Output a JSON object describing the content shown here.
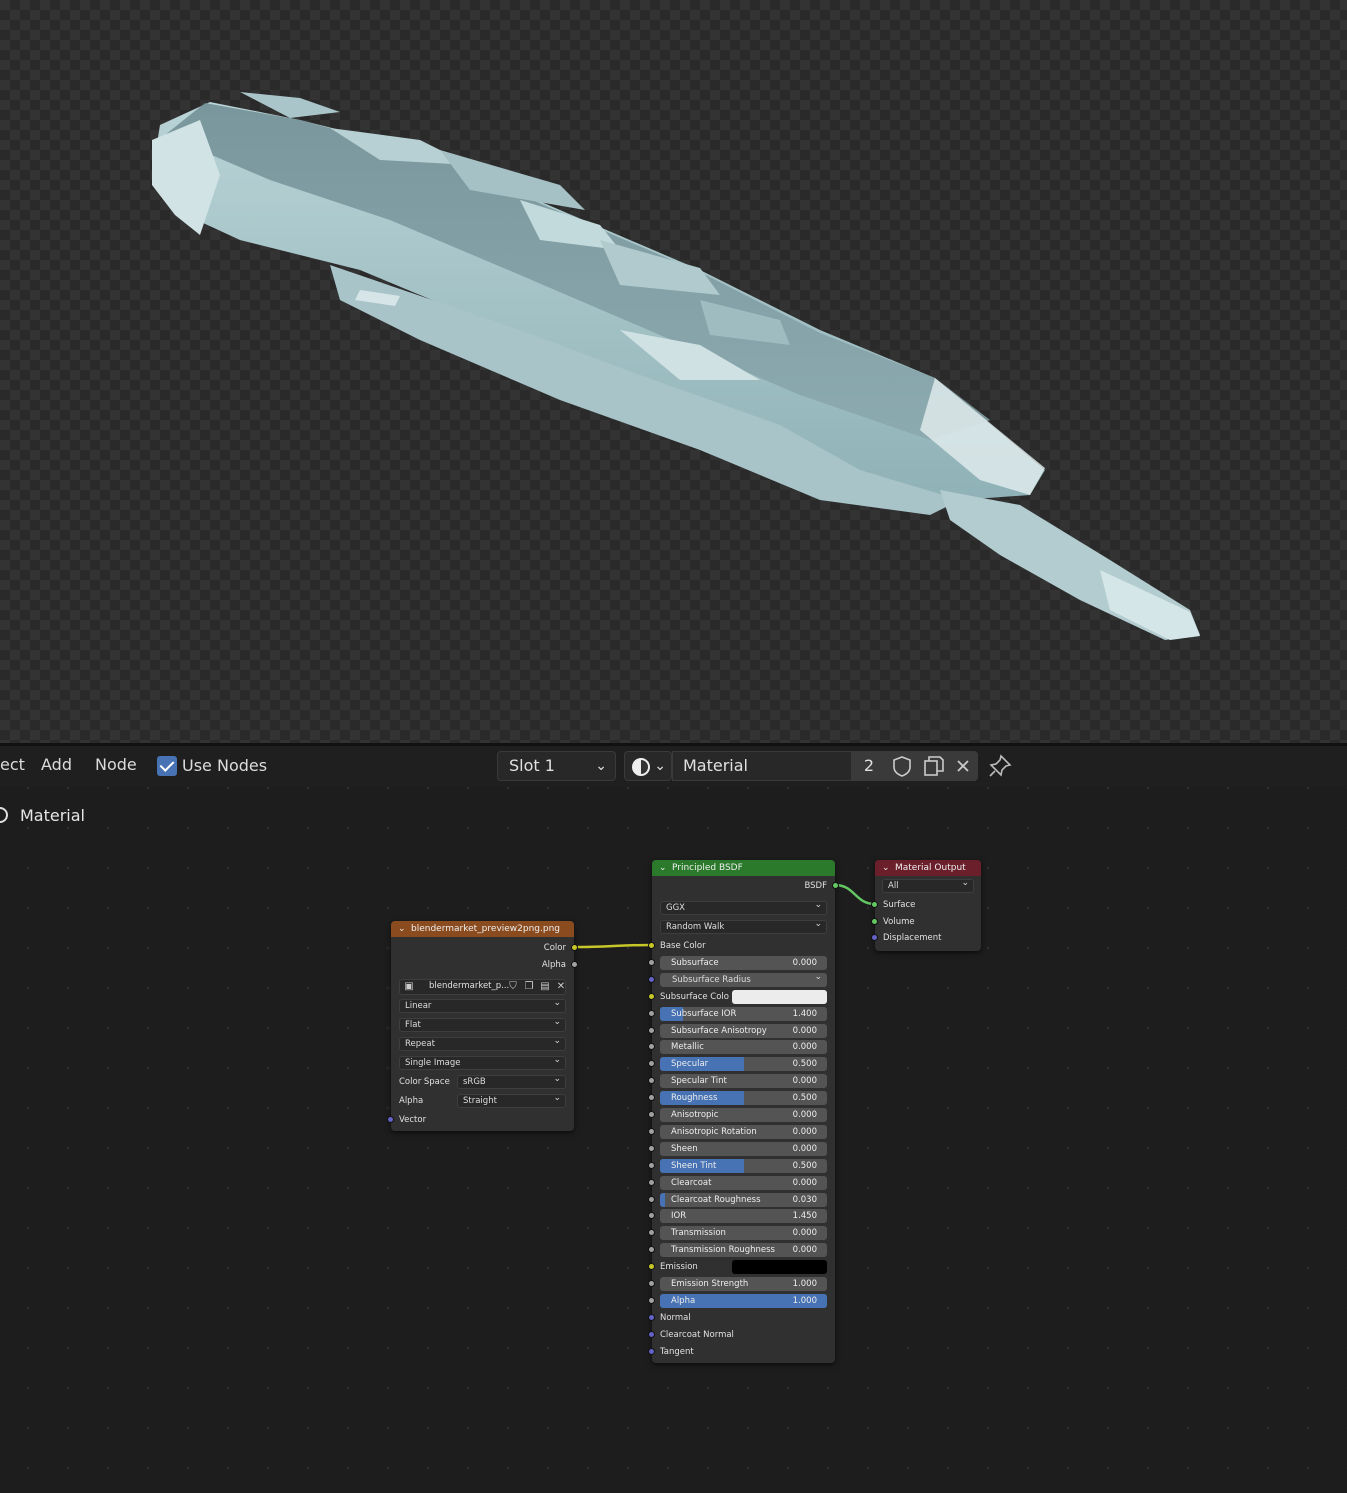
{
  "header": {
    "menu_select": "ect",
    "menu_add": "Add",
    "menu_node": "Node",
    "use_nodes_label": "Use Nodes",
    "use_nodes_checked": true,
    "slot": "Slot 1",
    "material_name": "Material",
    "user_count": "2"
  },
  "breadcrumb": {
    "label": "Material"
  },
  "image_node": {
    "title": "blendermarket_preview2png.png",
    "out_color": "Color",
    "out_alpha": "Alpha",
    "image_name": "blendermarket_p...",
    "interpolation": "Linear",
    "projection": "Flat",
    "extension": "Repeat",
    "source": "Single Image",
    "color_space_label": "Color Space",
    "color_space": "sRGB",
    "alpha_label": "Alpha",
    "alpha_mode": "Straight",
    "in_vector": "Vector"
  },
  "bsdf_node": {
    "title": "Principled BSDF",
    "out_bsdf": "BSDF",
    "distribution": "GGX",
    "subsurface_method": "Random Walk",
    "base_color": "Base Color",
    "subsurface": {
      "label": "Subsurface",
      "value": "0.000",
      "fill": 0
    },
    "subsurface_radius": "Subsurface Radius",
    "subsurface_color": "Subsurface Colo",
    "subsurface_ior": {
      "label": "Subsurface IOR",
      "value": "1.400",
      "fill": 0.14
    },
    "subsurface_anisotropy": {
      "label": "Subsurface Anisotropy",
      "value": "0.000",
      "fill": 0
    },
    "metallic": {
      "label": "Metallic",
      "value": "0.000",
      "fill": 0
    },
    "specular": {
      "label": "Specular",
      "value": "0.500",
      "fill": 0.5
    },
    "specular_tint": {
      "label": "Specular Tint",
      "value": "0.000",
      "fill": 0
    },
    "roughness": {
      "label": "Roughness",
      "value": "0.500",
      "fill": 0.5
    },
    "anisotropic": {
      "label": "Anisotropic",
      "value": "0.000",
      "fill": 0
    },
    "anisotropic_rotation": {
      "label": "Anisotropic Rotation",
      "value": "0.000",
      "fill": 0
    },
    "sheen": {
      "label": "Sheen",
      "value": "0.000",
      "fill": 0
    },
    "sheen_tint": {
      "label": "Sheen Tint",
      "value": "0.500",
      "fill": 0.5
    },
    "clearcoat": {
      "label": "Clearcoat",
      "value": "0.000",
      "fill": 0
    },
    "clearcoat_roughness": {
      "label": "Clearcoat Roughness",
      "value": "0.030",
      "fill": 0.03
    },
    "ior": {
      "label": "IOR",
      "value": "1.450",
      "fill": 0
    },
    "transmission": {
      "label": "Transmission",
      "value": "0.000",
      "fill": 0
    },
    "transmission_roughness": {
      "label": "Transmission Roughness",
      "value": "0.000",
      "fill": 0
    },
    "emission": "Emission",
    "emission_strength": {
      "label": "Emission Strength",
      "value": "1.000",
      "fill": 0
    },
    "alpha": {
      "label": "Alpha",
      "value": "1.000",
      "fill": 1
    },
    "normal": "Normal",
    "clearcoat_normal": "Clearcoat Normal",
    "tangent": "Tangent",
    "subsurface_color_value": "#ececec",
    "emission_color_value": "#000000"
  },
  "output_node": {
    "title": "Material Output",
    "target": "All",
    "in_surface": "Surface",
    "in_volume": "Volume",
    "in_displacement": "Displacement"
  },
  "colors": {
    "accent": "#4772b3",
    "image_header": "#8a4b1f",
    "bsdf_header": "#2b7a2b",
    "output_header": "#6b1f2b",
    "link_color": "#c7c729",
    "link_bsdf": "#63c763"
  }
}
